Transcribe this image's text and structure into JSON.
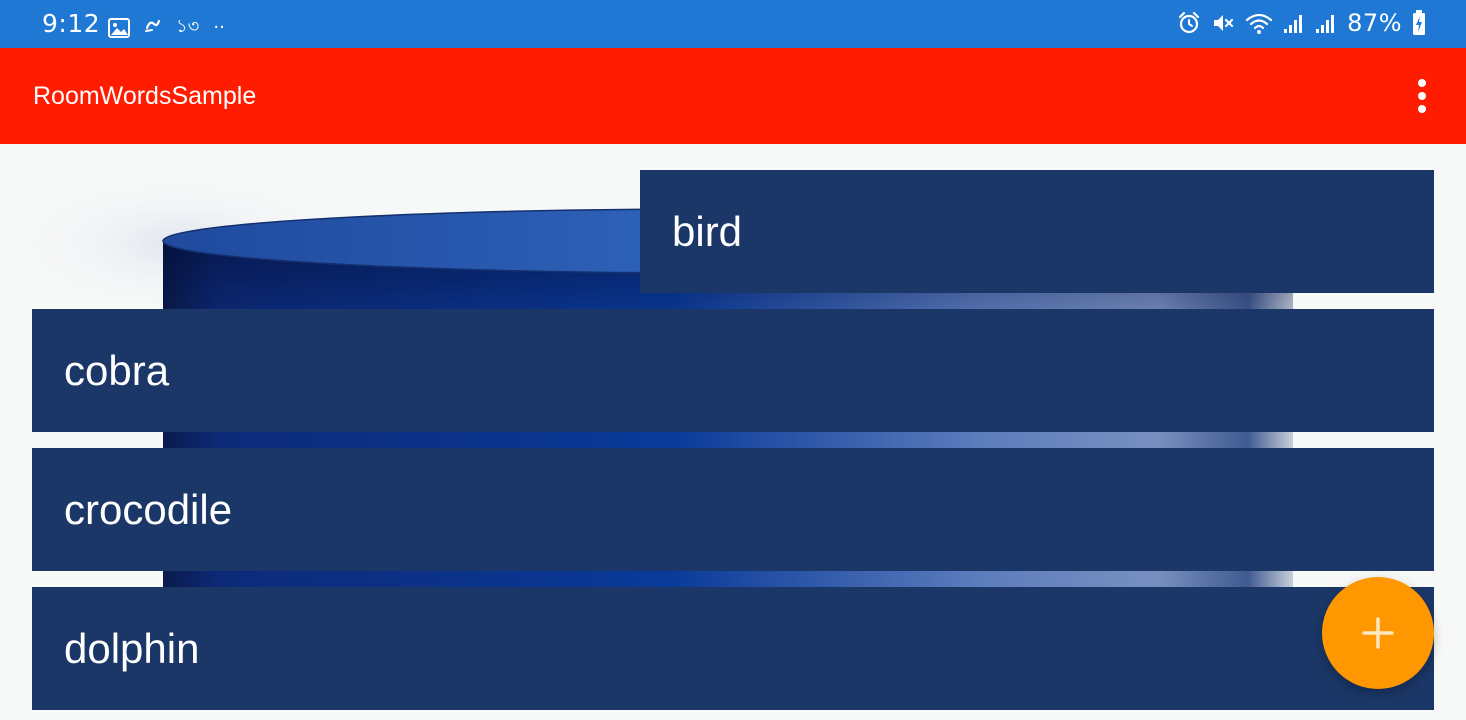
{
  "colors": {
    "status_bar": "#1f78d4",
    "app_bar": "#ff1c00",
    "card": "#1b3767",
    "fab": "#ff9800",
    "fab_icon": "#ffe8c2"
  },
  "status_bar": {
    "time": "9:12",
    "left_glyphs": [
      "১৩",
      "··"
    ],
    "battery_percent": "87%",
    "icons": [
      "gallery-icon",
      "notification-icon",
      "alarm-icon",
      "mute-icon",
      "wifi-icon",
      "signal-icon",
      "signal-icon",
      "battery-charging-icon"
    ]
  },
  "app_bar": {
    "title": "RoomWordsSample",
    "menu_icon": "overflow-menu-icon"
  },
  "words": [
    "bird",
    "cobra",
    "crocodile",
    "dolphin"
  ],
  "fab": {
    "icon": "add-icon"
  }
}
